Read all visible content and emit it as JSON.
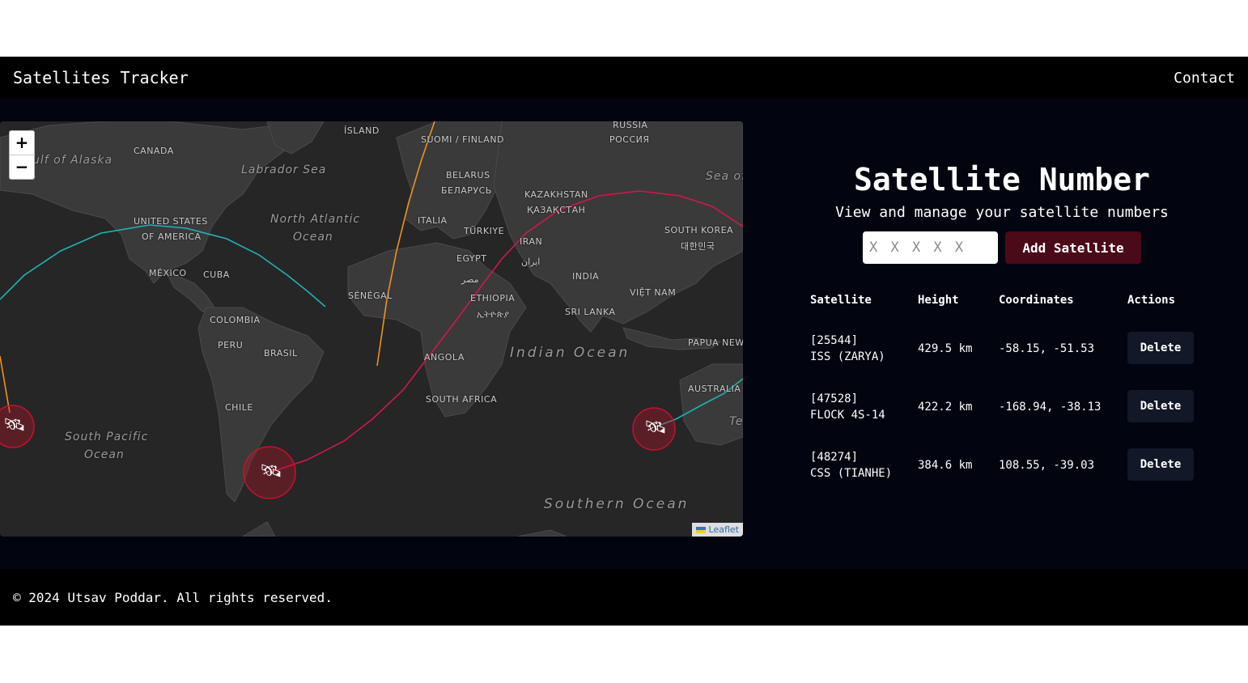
{
  "header": {
    "brand": "Satellites Tracker",
    "contact": "Contact"
  },
  "map": {
    "zoom_in": "+",
    "zoom_out": "−",
    "attribution": "Leaflet",
    "labels": {
      "canada": "CANADA",
      "gulf_alaska": "ulf of Alaska",
      "labrador": "Labrador Sea",
      "island": "ÍSLAND",
      "finland": "SUOMI / FINLAND",
      "russia_en": "RUSSIA",
      "russia_ru": "РОССИЯ",
      "sea_of": "Sea of",
      "belarus_en": "BELARUS",
      "belarus_ru": "БЕЛАРУСЬ",
      "kazakhstan_en": "KAZAKHSTAN",
      "kazakhstan_kz": "ҚАЗАҚСТАН",
      "usa_1": "UNITED STATES",
      "usa_2": "OF AMERICA",
      "n_atlantic_1": "North Atlantic",
      "n_atlantic_2": "Ocean",
      "italia": "ITALIA",
      "turkiye": "TÜRKIYE",
      "iran_en": "IRAN",
      "iran_fa": "ایران",
      "south_korea_en": "SOUTH KOREA",
      "south_korea_ko": "대한민국",
      "egypt_en": "EGYPT",
      "egypt_ar": "مصر",
      "mexico": "MÉXICO",
      "cuba": "CUBA",
      "senegal": "SÉNÉGAL",
      "india": "INDIA",
      "vietnam": "VIỆT NAM",
      "ethiopia_en": "ETHIOPIA",
      "ethiopia_am": "ኢትዮጵያ",
      "sri_lanka": "SRI LANKA",
      "colombia": "COLOMBIA",
      "peru": "PERU",
      "brasil": "BRASIL",
      "angola": "ANGOLA",
      "indian_ocean": "Indian Ocean",
      "papua": "PAPUA NEW",
      "australia": "AUSTRALIA",
      "chile": "CHILE",
      "south_africa": "SOUTH AFRICA",
      "s_pacific_1": "South Pacific",
      "s_pacific_2": "Ocean",
      "southern_ocean": "Southern Ocean",
      "te": "Te"
    },
    "track_colors": {
      "orange": "#f0921c",
      "crimson": "#d3174a",
      "teal": "#1fb3b8"
    }
  },
  "panel": {
    "title": "Satellite Number",
    "subtitle": "View and manage your satellite numbers",
    "input_placeholder": "X X X X X",
    "add_label": "Add Satellite",
    "columns": [
      "Satellite",
      "Height",
      "Coordinates",
      "Actions"
    ],
    "rows": [
      {
        "id": "[25544]",
        "name": "ISS (ZARYA)",
        "height": "429.5 km",
        "coords": "-58.15, -51.53",
        "action": "Delete"
      },
      {
        "id": "[47528]",
        "name": "FLOCK 4S-14",
        "height": "422.2 km",
        "coords": "-168.94, -38.13",
        "action": "Delete"
      },
      {
        "id": "[48274]",
        "name": "CSS (TIANHE)",
        "height": "384.6 km",
        "coords": "108.55, -39.03",
        "action": "Delete"
      }
    ]
  },
  "footer": {
    "text": "© 2024 Utsav Poddar. All rights reserved."
  }
}
